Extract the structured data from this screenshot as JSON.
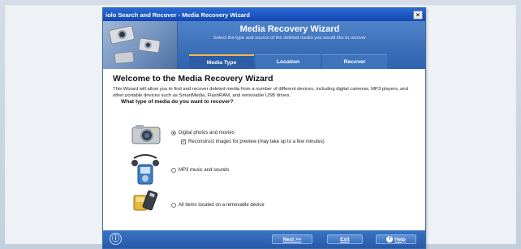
{
  "window": {
    "title": "iolo Search and Recover - Media Recovery Wizard",
    "close_glyph": "×"
  },
  "banner": {
    "title": "Media Recovery Wizard",
    "subtitle": "Select the type and source of the deleted media you would like to recover",
    "steps": [
      {
        "label": "Media Type",
        "active": true
      },
      {
        "label": "Location",
        "active": false
      },
      {
        "label": "Recover",
        "active": false
      }
    ]
  },
  "content": {
    "heading": "Welcome to the Media Recovery Wizard",
    "intro": "This Wizard will allow you to find and recover deleted media from a number of different devices, including digital cameras, MP3 players, and other portable devices such as SmartMedia, FlashRAM, and removable USB drives.",
    "question": "What type of media do you want to recover?",
    "options": [
      {
        "label": "Digital photos and movies",
        "selected": true,
        "icon": "camera-icon"
      },
      {
        "label": "MP3 music and sounds",
        "selected": false,
        "icon": "mp3-player-icon"
      },
      {
        "label": "All items located on a removable device",
        "selected": false,
        "icon": "flash-card-icon"
      }
    ],
    "reconstruct": {
      "label": "Reconstruct images for preview (may take up to a few minutes)",
      "checked": true,
      "check_glyph": "✓"
    }
  },
  "footer": {
    "info_glyph": "ⓘ",
    "next_label": "Next >>",
    "exit_label": "Exit",
    "help_label": "Help",
    "help_glyph": "?"
  },
  "colors": {
    "titlebar": "#1f5ac6",
    "banner": "#3a6fb8",
    "step_active_accent": "#f7b54a",
    "footer": "#2f66b6"
  }
}
